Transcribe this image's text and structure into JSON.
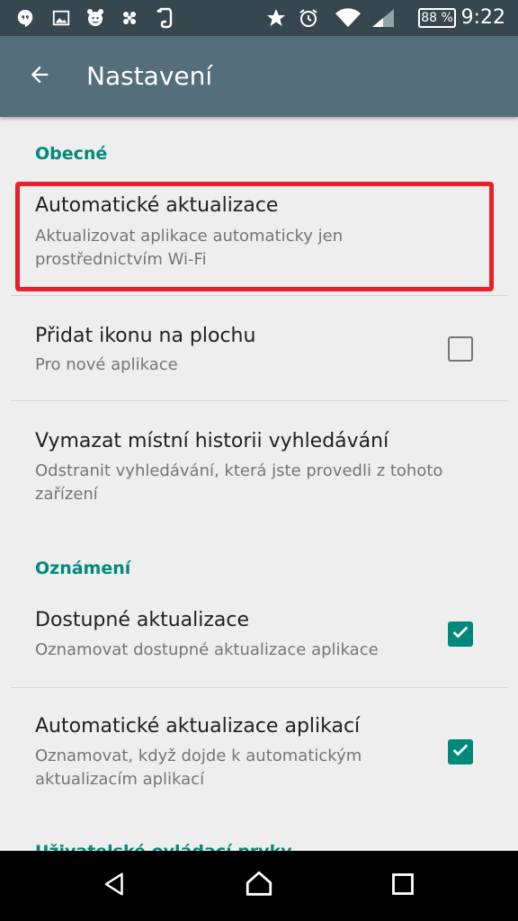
{
  "status_bar": {
    "left_icons": [
      "hangouts-icon",
      "gallery-icon",
      "alarm-clock-app-icon",
      "bird-icon",
      "evernote-icon"
    ],
    "right_icons": [
      "star-icon",
      "alarm-icon",
      "wifi-icon",
      "signal-icon"
    ],
    "battery": "88 %",
    "time": "9:22"
  },
  "toolbar": {
    "title": "Nastavení"
  },
  "sections": {
    "general": "Obecné",
    "notifications": "Oznámení",
    "user_controls": "Uživatelské ovládací prvky"
  },
  "prefs": {
    "auto_update": {
      "title": "Automatické aktualizace",
      "summary": "Aktualizovat aplikace automaticky jen prostřednictvím Wi-Fi"
    },
    "add_icon": {
      "title": "Přidat ikonu na plochu",
      "summary": "Pro nové aplikace",
      "checked": false
    },
    "clear_history": {
      "title": "Vymazat místní historii vyhledávání",
      "summary": "Odstranit vyhledávání, která jste provedli z tohoto zařízení"
    },
    "available_updates": {
      "title": "Dostupné aktualizace",
      "summary": "Oznamovat dostupné aktualizace aplikace",
      "checked": true
    },
    "auto_app_updates": {
      "title": "Automatické aktualizace aplikací",
      "summary": "Oznamovat, když dojde k automatickým aktualizacím aplikací",
      "checked": true
    }
  },
  "colors": {
    "accent": "#00897b",
    "toolbar": "#546e7a",
    "status_bar": "#37474f",
    "highlight": "#e8202b"
  }
}
